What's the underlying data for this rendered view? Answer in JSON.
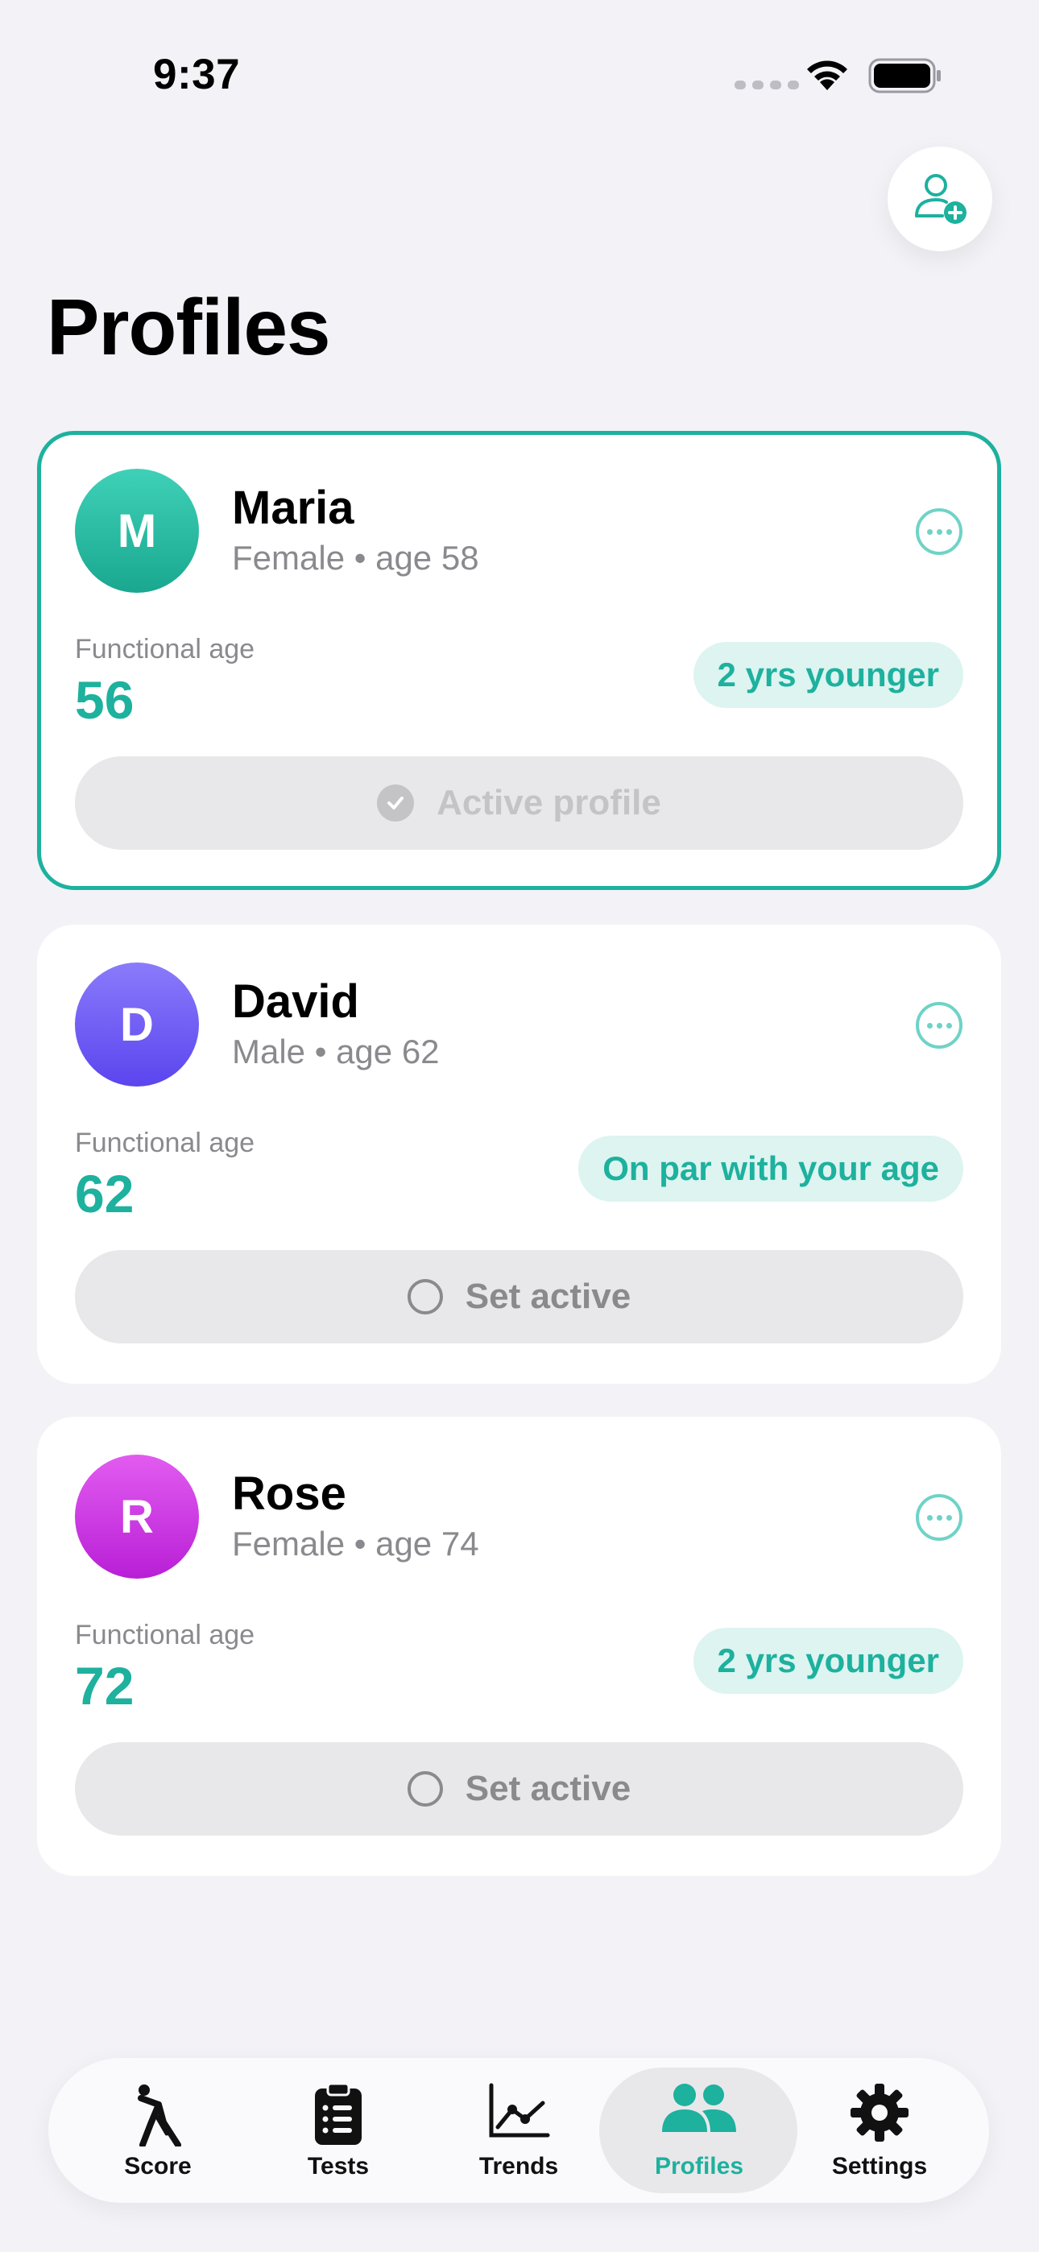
{
  "status_bar": {
    "time": "9:37"
  },
  "header": {
    "title": "Profiles"
  },
  "colors": {
    "accent": "#1DB19E",
    "background": "#F2F2F7",
    "badge_bg": "#DDF4F0"
  },
  "profiles": [
    {
      "initial": "M",
      "name": "Maria",
      "meta": "Female • age 58",
      "functional_age_label": "Functional age",
      "functional_age": "56",
      "comparison": "2 yrs younger",
      "action_label": "Active profile",
      "active": true,
      "avatar_gradient": [
        "#3FD1B8",
        "#19A78F"
      ]
    },
    {
      "initial": "D",
      "name": "David",
      "meta": "Male • age 62",
      "functional_age_label": "Functional age",
      "functional_age": "62",
      "comparison": "On par with your age",
      "action_label": "Set active",
      "active": false,
      "avatar_gradient": [
        "#8A7BFB",
        "#5B45EE"
      ]
    },
    {
      "initial": "R",
      "name": "Rose",
      "meta": "Female • age 74",
      "functional_age_label": "Functional age",
      "functional_age": "72",
      "comparison": "2 yrs younger",
      "action_label": "Set active",
      "active": false,
      "avatar_gradient": [
        "#E25CF0",
        "#B81FD6"
      ]
    }
  ],
  "tab_bar": {
    "tabs": [
      {
        "label": "Score",
        "icon": "figure-stretch-icon"
      },
      {
        "label": "Tests",
        "icon": "clipboard-list-icon"
      },
      {
        "label": "Trends",
        "icon": "line-chart-icon"
      },
      {
        "label": "Profiles",
        "icon": "people-icon",
        "selected": true
      },
      {
        "label": "Settings",
        "icon": "gear-icon"
      }
    ]
  }
}
